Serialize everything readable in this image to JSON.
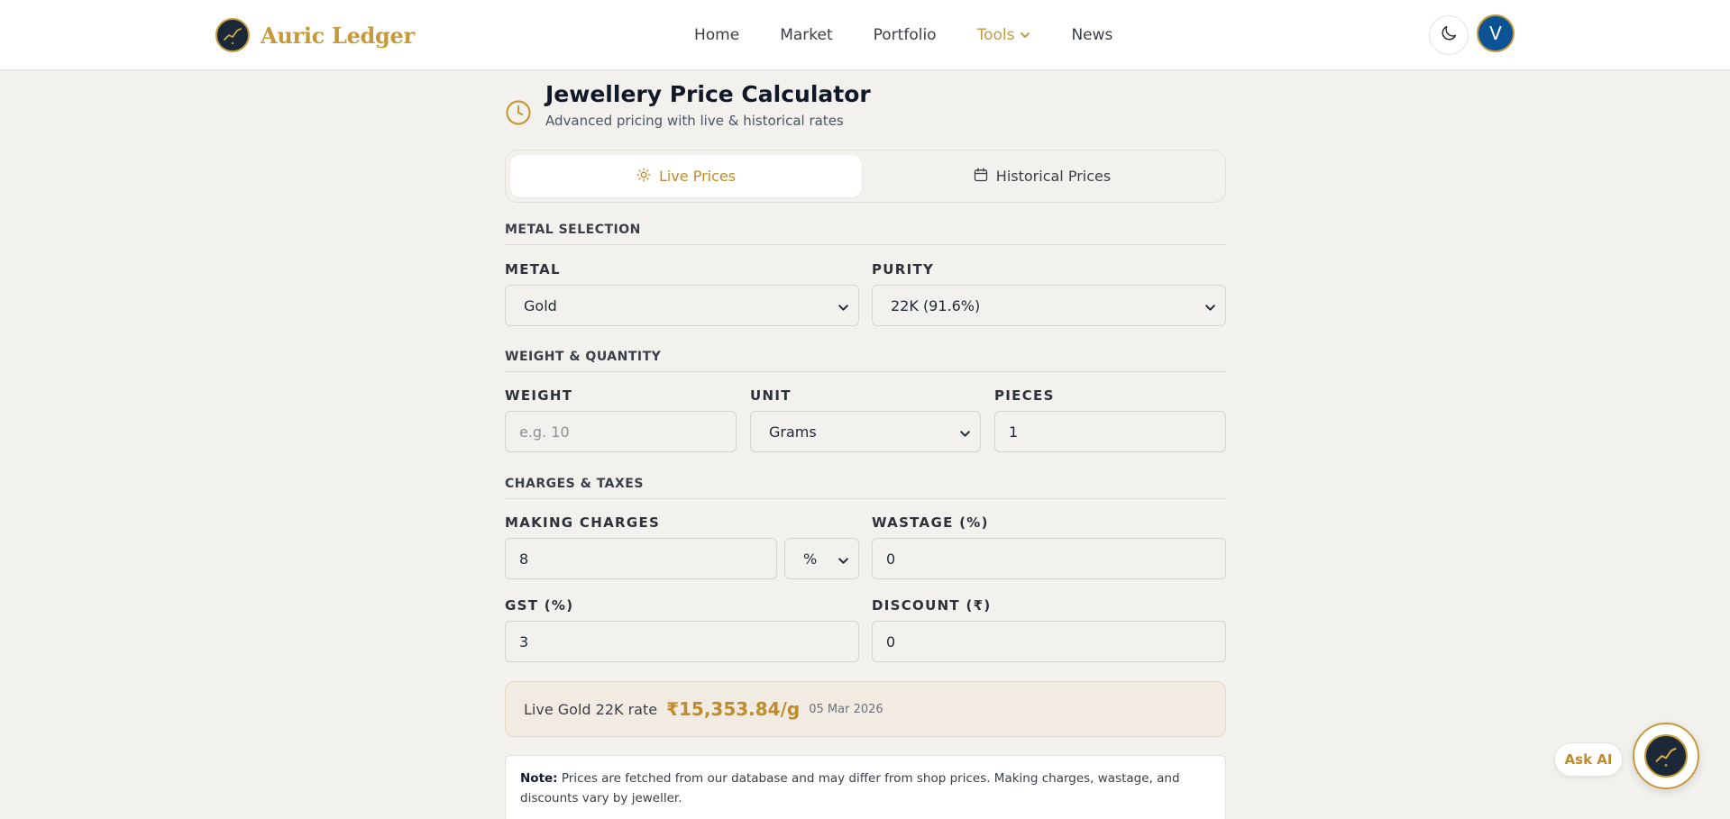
{
  "header": {
    "brand": "Auric Ledger",
    "nav": [
      {
        "label": "Home"
      },
      {
        "label": "Market"
      },
      {
        "label": "Portfolio"
      },
      {
        "label": "Tools"
      },
      {
        "label": "News"
      }
    ],
    "avatar_initial": "V"
  },
  "page": {
    "title": "Jewellery Price Calculator",
    "subtitle": "Advanced pricing with live & historical rates"
  },
  "tabs": {
    "live": "Live Prices",
    "historical": "Historical Prices"
  },
  "sections": {
    "metal": "METAL SELECTION",
    "weight": "WEIGHT & QUANTITY",
    "charges": "CHARGES & TAXES"
  },
  "fields": {
    "metal": {
      "label": "METAL",
      "value": "Gold"
    },
    "purity": {
      "label": "PURITY",
      "value": "22K (91.6%)"
    },
    "weight": {
      "label": "WEIGHT",
      "placeholder": "e.g. 10"
    },
    "unit": {
      "label": "UNIT",
      "value": "Grams"
    },
    "pieces": {
      "label": "PIECES",
      "value": "1"
    },
    "making_charges": {
      "label": "MAKING CHARGES",
      "value": "8",
      "type": "%"
    },
    "wastage": {
      "label": "WASTAGE (%)",
      "value": "0"
    },
    "gst": {
      "label": "GST (%)",
      "value": "3"
    },
    "discount": {
      "label": "DISCOUNT (₹)",
      "value": "0"
    }
  },
  "rate": {
    "label": "Live Gold 22K rate",
    "value": "₹15,353.84/g",
    "date": "05 Mar 2026"
  },
  "note": {
    "prefix": "Note:",
    "text": "Prices are fetched from our database and may differ from shop prices. Making charges, wastage, and discounts vary by jeweller."
  },
  "ask_ai": "Ask AI",
  "colors": {
    "accent": "#c59a3c",
    "background": "#f2f1ee",
    "navy": "#1b2838",
    "avatar": "#0b5394"
  }
}
